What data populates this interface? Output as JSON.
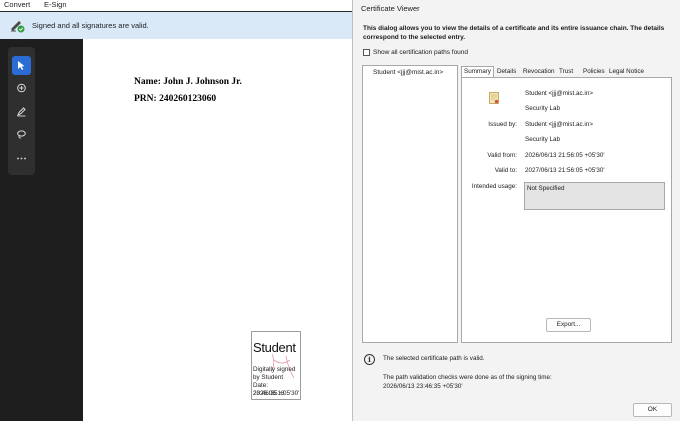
{
  "menu": {
    "convert": "Convert",
    "esign": "E-Sign"
  },
  "signature_bar": {
    "message": "Signed and all signatures are valid.",
    "icon": "signature-valid-icon"
  },
  "tools": [
    {
      "name": "select-tool",
      "icon": "cursor-icon",
      "active": true
    },
    {
      "name": "comment-tool",
      "icon": "comment-icon",
      "active": false
    },
    {
      "name": "highlight-tool",
      "icon": "pen-icon",
      "active": false
    },
    {
      "name": "draw-tool",
      "icon": "lasso-icon",
      "active": false
    },
    {
      "name": "more-tools",
      "icon": "ellipsis-icon",
      "active": false
    }
  ],
  "document": {
    "name_line": "Name: John J. Johnson Jr.",
    "prn_line": "PRN: 240260123060"
  },
  "signature_stamp": {
    "name": "Student",
    "lines": [
      "Digitally signed",
      "by Student",
      "Date: 2026.06.13",
      "23:46:35 +05'30'"
    ]
  },
  "dialog": {
    "title": "Certificate Viewer",
    "intro": "This dialog allows you to view the details of a certificate and its entire issuance chain. The details correspond to the selected entry.",
    "show_all_label": "Show all certification paths found",
    "show_all_checked": false,
    "tree_item": "Student <jjj@mist.ac.in>",
    "tabs": [
      "Summary",
      "Details",
      "Revocation",
      "Trust",
      "Policies",
      "Legal Notice"
    ],
    "active_tab": "Summary",
    "summary": {
      "subject_name": "Student <jjj@mist.ac.in>",
      "subject_org": "Security Lab",
      "issued_by_label": "Issued by:",
      "issuer_name": "Student <jjj@mist.ac.in>",
      "issuer_org": "Security Lab",
      "valid_from_label": "Valid from:",
      "valid_from": "2026/06/13 21:56:05 +05'30'",
      "valid_to_label": "Valid to:",
      "valid_to": "2027/06/13 21:56:05 +05'30'",
      "intended_usage_label": "Intended usage:",
      "intended_usage": "Not Specified"
    },
    "export_label": "Export...",
    "validity_message": "The selected certificate path is valid.",
    "check_message": "The path validation checks were done as of the signing time:",
    "check_time": "2026/06/13 23:46:35 +05'30'",
    "ok_label": "OK"
  }
}
